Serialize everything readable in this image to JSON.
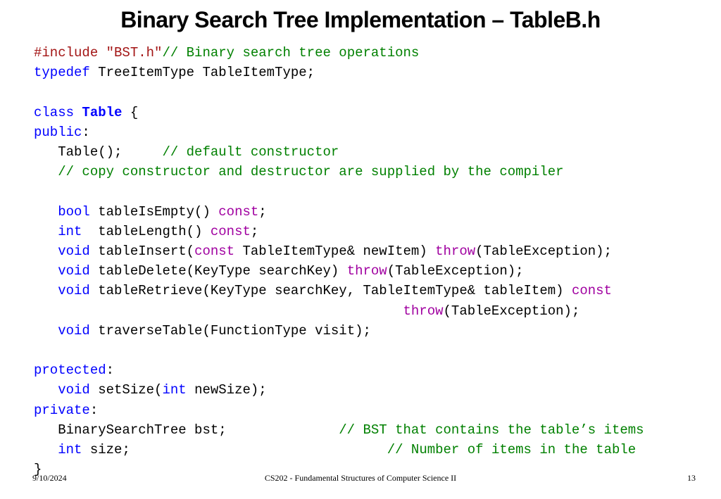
{
  "title": "Binary Search Tree Implementation – TableB.h",
  "code": {
    "l1": {
      "s1": "#include ",
      "s2": "\"BST.h\"",
      "s3": "// Binary search tree operations"
    },
    "l2": {
      "s1": "typedef",
      "s2": " TreeItemType TableItemType;"
    },
    "l3": "",
    "l4": {
      "s1": "class",
      "s2": " ",
      "s3": "Table",
      "s4": " {"
    },
    "l5": {
      "s1": "public",
      "s2": ":"
    },
    "l6": {
      "s1": "   Table();     ",
      "s2": "// default constructor"
    },
    "l7": {
      "s1": "   ",
      "s2": "// copy constructor and destructor are supplied by the compiler"
    },
    "l8": "",
    "l9": {
      "s1": "   ",
      "s2": "bool",
      "s3": " tableIsEmpty() ",
      "s4": "const",
      "s5": ";"
    },
    "l10": {
      "s1": "   ",
      "s2": "int",
      "s3": "  tableLength() ",
      "s4": "const",
      "s5": ";"
    },
    "l11": {
      "s1": "   ",
      "s2": "void",
      "s3": " tableInsert(",
      "s4": "const",
      "s5": " TableItemType& newItem) ",
      "s6": "throw",
      "s7": "(TableException);"
    },
    "l12": {
      "s1": "   ",
      "s2": "void",
      "s3": " tableDelete(KeyType searchKey) ",
      "s4": "throw",
      "s5": "(TableException);"
    },
    "l13": {
      "s1": "   ",
      "s2": "void",
      "s3": " tableRetrieve(KeyType searchKey, TableItemType& tableItem) ",
      "s4": "const"
    },
    "l14": {
      "s1": "                                              ",
      "s2": "throw",
      "s3": "(TableException);"
    },
    "l15": {
      "s1": "   ",
      "s2": "void",
      "s3": " traverseTable(FunctionType visit);"
    },
    "l16": "",
    "l17": {
      "s1": "protected",
      "s2": ":"
    },
    "l18": {
      "s1": "   ",
      "s2": "void",
      "s3": " setSize(",
      "s4": "int",
      "s5": " newSize);"
    },
    "l19": {
      "s1": "private",
      "s2": ":"
    },
    "l20": {
      "s1": "   BinarySearchTree bst;              ",
      "s2": "// BST that contains the table’s items"
    },
    "l21": {
      "s1": "   ",
      "s2": "int",
      "s3": " size;                                ",
      "s4": "// Number of items in the table"
    },
    "l22": "}"
  },
  "footer": {
    "date": "9/10/2024",
    "center": "CS202 - Fundamental Structures of Computer Science II",
    "page": "13"
  }
}
